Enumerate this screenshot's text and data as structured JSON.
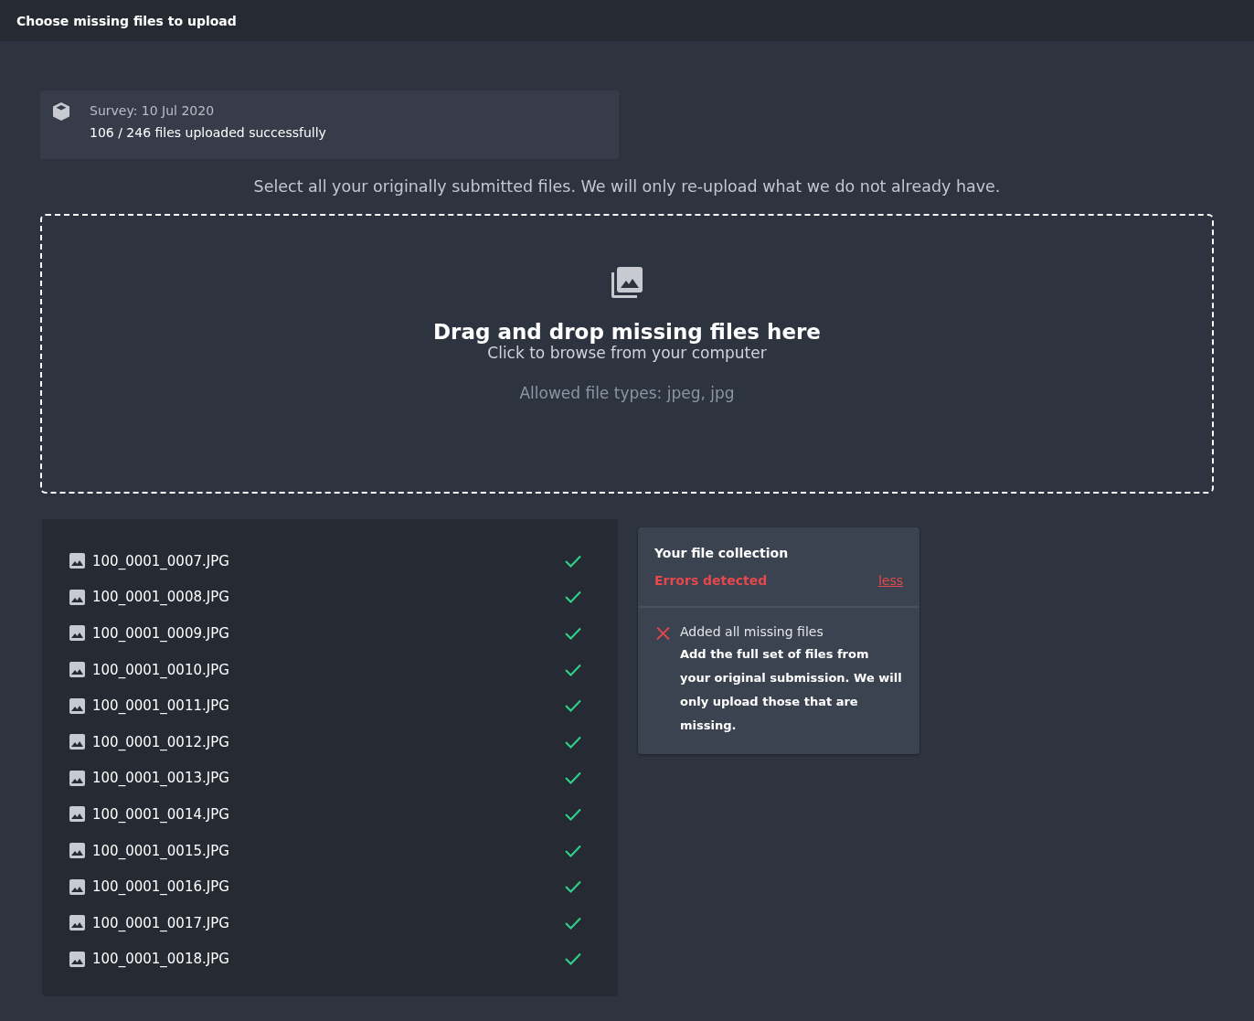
{
  "header": {
    "title": "Choose missing files to upload"
  },
  "survey": {
    "title": "Survey: 10 Jul 2020",
    "status": "106 / 246 files uploaded successfully"
  },
  "instruction": "Select all your originally submitted files. We will only re-upload what we do not already have.",
  "dropzone": {
    "title": "Drag and drop missing files here",
    "subtitle": "Click to browse from your computer",
    "allowed": "Allowed file types: jpeg, jpg"
  },
  "files": [
    {
      "name": "100_0001_0007.JPG",
      "uploaded": true
    },
    {
      "name": "100_0001_0008.JPG",
      "uploaded": true
    },
    {
      "name": "100_0001_0009.JPG",
      "uploaded": true
    },
    {
      "name": "100_0001_0010.JPG",
      "uploaded": true
    },
    {
      "name": "100_0001_0011.JPG",
      "uploaded": true
    },
    {
      "name": "100_0001_0012.JPG",
      "uploaded": true
    },
    {
      "name": "100_0001_0013.JPG",
      "uploaded": true
    },
    {
      "name": "100_0001_0014.JPG",
      "uploaded": true
    },
    {
      "name": "100_0001_0015.JPG",
      "uploaded": true
    },
    {
      "name": "100_0001_0016.JPG",
      "uploaded": true
    },
    {
      "name": "100_0001_0017.JPG",
      "uploaded": true
    },
    {
      "name": "100_0001_0018.JPG",
      "uploaded": true
    }
  ],
  "collection": {
    "title": "Your file collection",
    "status": "Errors detected",
    "toggle": "less",
    "checks": [
      {
        "label": "Added all missing files",
        "passed": false,
        "detail": "Add the full set of files from your original submission. We will only upload those that are missing."
      }
    ]
  }
}
